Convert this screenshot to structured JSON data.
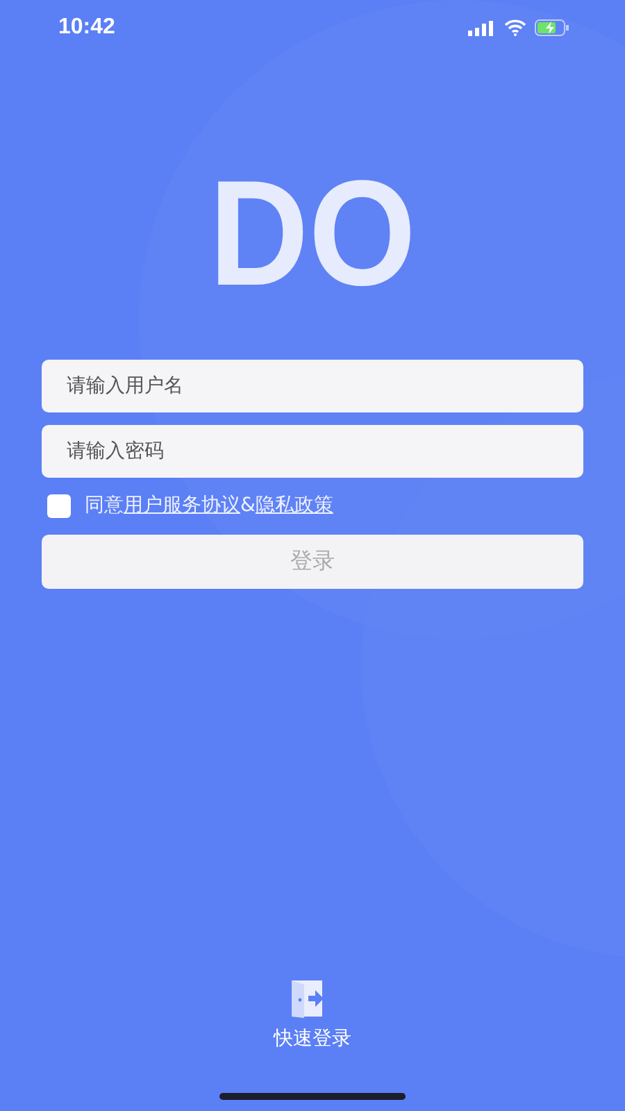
{
  "status_bar": {
    "time": "10:42"
  },
  "logo": {
    "text": "DO"
  },
  "form": {
    "username": {
      "placeholder": "请输入用户名"
    },
    "password": {
      "placeholder": "请输入密码"
    },
    "agreement": {
      "checked": false,
      "prefix": "同意",
      "link_1": "用户服务协议",
      "joiner": "&",
      "link_2": "隐私政策"
    },
    "login_button": {
      "label": "登录",
      "disabled": true
    }
  },
  "quick_login": {
    "label": "快速登录"
  }
}
